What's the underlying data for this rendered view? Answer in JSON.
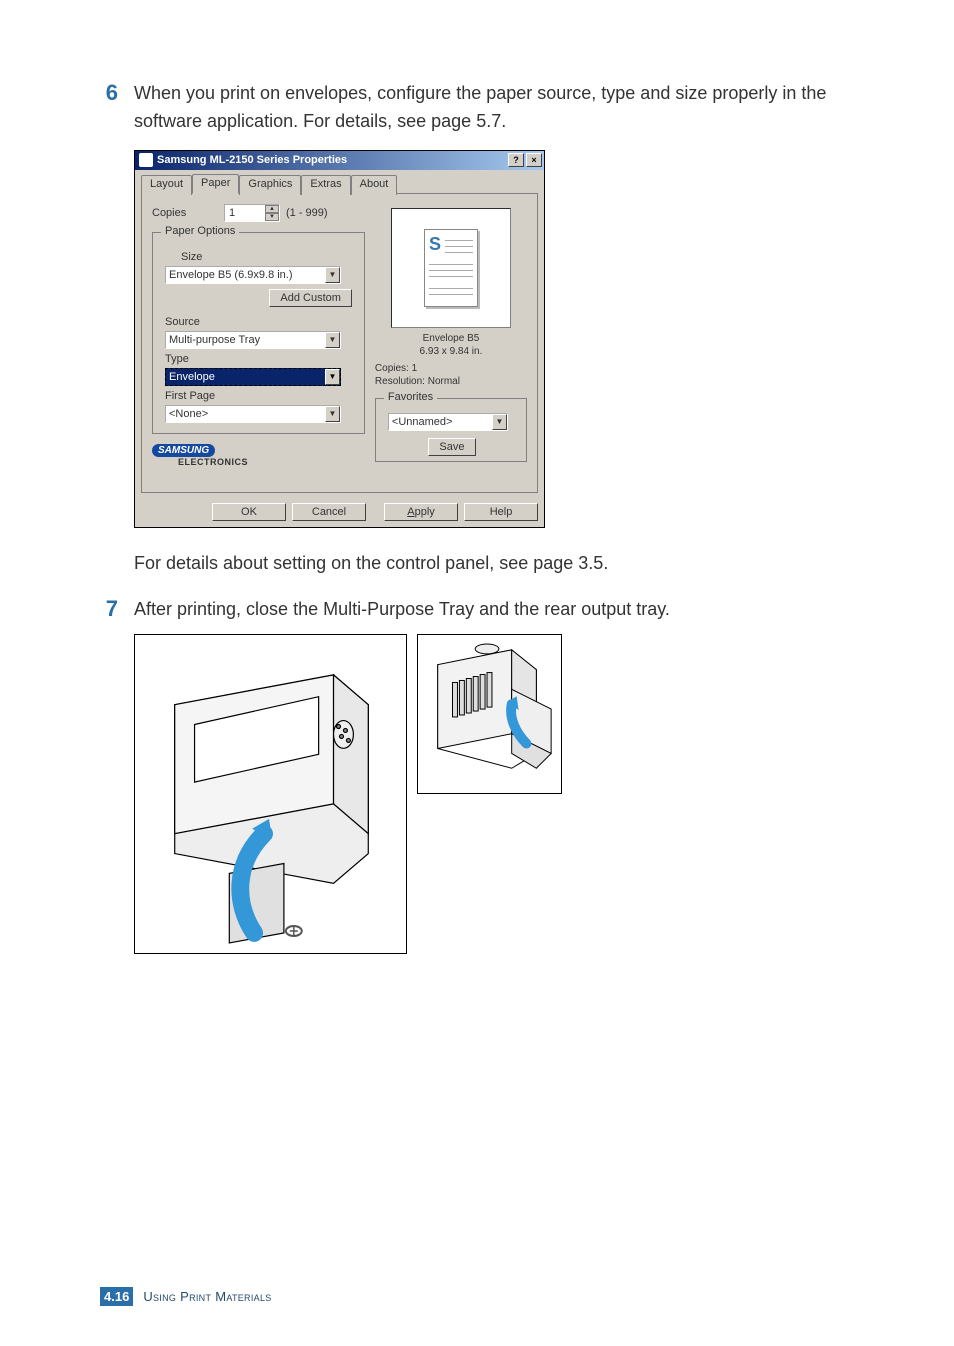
{
  "steps": {
    "6": {
      "num": "6",
      "text": "When you print on envelopes, configure the paper source, type and size properly in the software application. For details, see page 5.7."
    },
    "note6": "For details about setting on the control panel, see page 3.5.",
    "7": {
      "num": "7",
      "text": "After printing, close the Multi-Purpose Tray and the rear output tray."
    }
  },
  "dialog": {
    "title": "Samsung ML-2150 Series Properties",
    "tabs": [
      "Layout",
      "Paper",
      "Graphics",
      "Extras",
      "About"
    ],
    "copies_label": "Copies",
    "copies_value": "1",
    "copies_range": "(1 - 999)",
    "paper_options_legend": "Paper Options",
    "size_label": "Size",
    "size_value": "Envelope B5 (6.9x9.8 in.)",
    "add_custom": "Add Custom",
    "source_label": "Source",
    "source_value": "Multi-purpose Tray",
    "type_label": "Type",
    "type_value": "Envelope",
    "firstpage_label": "First Page",
    "firstpage_value": "<None>",
    "preview": {
      "name": "Envelope B5",
      "dims": "6.93 x 9.84 in.",
      "copies": "Copies: 1",
      "resolution": "Resolution: Normal"
    },
    "favorites_legend": "Favorites",
    "favorites_value": "<Unnamed>",
    "save": "Save",
    "brand": "SAMSUNG",
    "brand2": "ELECTRONICS",
    "buttons": {
      "ok": "OK",
      "cancel": "Cancel",
      "apply": "Apply",
      "help": "Help"
    }
  },
  "footer": {
    "chapter": "4.",
    "page": "16",
    "title": "Using Print Materials"
  }
}
